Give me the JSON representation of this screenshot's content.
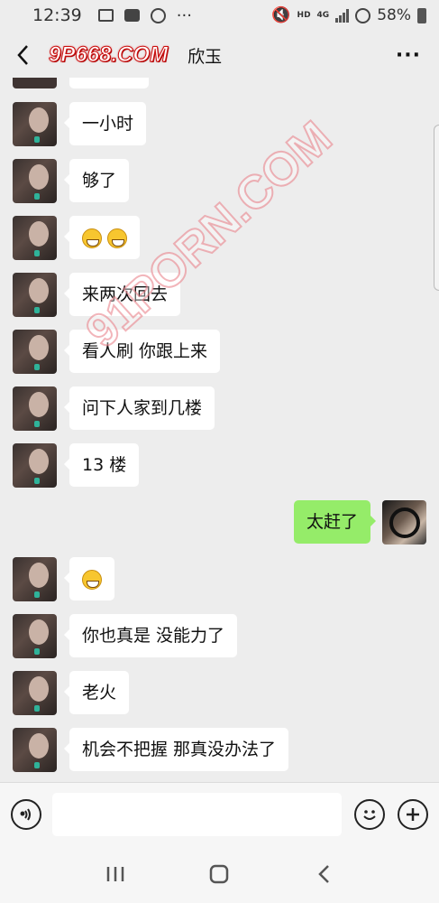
{
  "status_bar": {
    "time": "12:39",
    "network_hd": "HD",
    "network_4g": "4G",
    "battery": "58%"
  },
  "header": {
    "logo_text": "9P668.COM",
    "chat_name": "欣玉",
    "more": "···"
  },
  "watermark": "91PORN.COM",
  "messages": [
    {
      "side": "left",
      "text": "一小时"
    },
    {
      "side": "left",
      "text": "够了"
    },
    {
      "side": "left",
      "text": "",
      "emoji": [
        "grin-icon",
        "grimace-icon"
      ]
    },
    {
      "side": "left",
      "text": "来两次回去"
    },
    {
      "side": "left",
      "text": "看人刷 你跟上来"
    },
    {
      "side": "left",
      "text": "问下人家到几楼"
    },
    {
      "side": "left",
      "text": "13 楼"
    },
    {
      "side": "right",
      "text": "太赶了"
    },
    {
      "side": "left",
      "text": "",
      "emoji": [
        "laugh-cry-icon"
      ]
    },
    {
      "side": "left",
      "text": "你也真是 没能力了"
    },
    {
      "side": "left",
      "text": "老火"
    },
    {
      "side": "left",
      "text": "机会不把握 那真没办法了"
    }
  ],
  "input_bar": {
    "placeholder": ""
  }
}
